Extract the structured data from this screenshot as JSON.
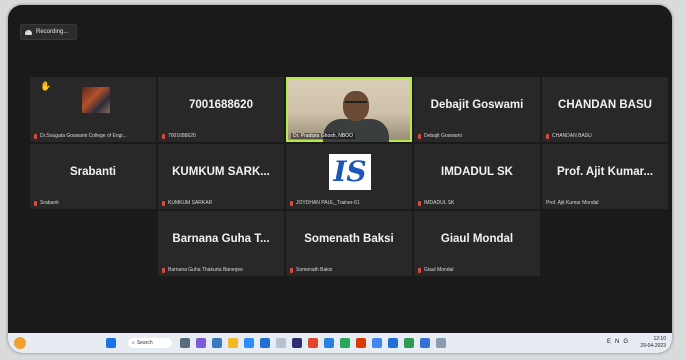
{
  "recording": {
    "label": "Recording..."
  },
  "tiles": [
    {
      "name": "",
      "label": "Dr.Sougata Goswami College of Engi..."
    },
    {
      "name": "7001688620",
      "label": "7001688620"
    },
    {
      "name": "",
      "label": "Dr. Pradipta Ghosh, NBOO"
    },
    {
      "name": "Debajit Goswami",
      "label": "Debajit Goswami"
    },
    {
      "name": "CHANDAN BASU",
      "label": "CHANDAN BASU"
    },
    {
      "name": "Srabanti",
      "label": "Srabanti"
    },
    {
      "name": "KUMKUM SARK...",
      "label": "KUMKUM SARKAR"
    },
    {
      "name": "",
      "label": "JOYDHAN PAUL_Trainer-61"
    },
    {
      "name": "IMDADUL SK",
      "label": "IMDADUL SK"
    },
    {
      "name": "Prof. Ajit Kumar...",
      "label": "Prof. Ajit Kumar Mondal"
    },
    {
      "name": "Barnana Guha T...",
      "label": "Barnana Guha Thakurta Banerjee"
    },
    {
      "name": "Somenath Baksi",
      "label": "Somenath Baksi"
    },
    {
      "name": "Giaul Mondal",
      "label": "Giaul Mondal"
    }
  ],
  "logo": {
    "text": "IS"
  },
  "taskbar": {
    "search_label": "Search",
    "time": "12:10",
    "date": "29-04-2023",
    "tray_text": "ENG"
  },
  "colors": {
    "active_border": "#b5e94a",
    "tile_bg": "#282828",
    "mic_muted": "#e0483d"
  }
}
